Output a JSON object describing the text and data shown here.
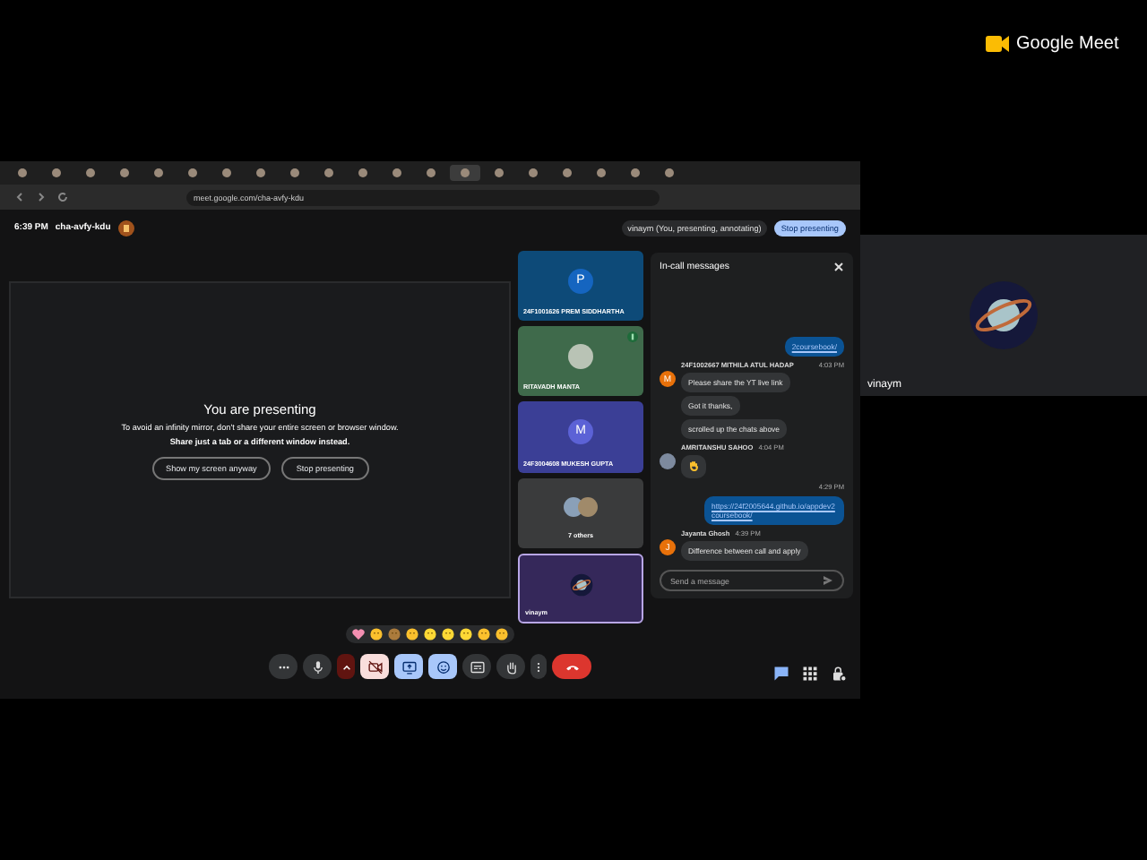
{
  "brand": {
    "name": "Google Meet"
  },
  "side_tile": {
    "name": "vinaym",
    "kind": "planet"
  },
  "browser": {
    "tabs": [
      {
        "selected": false
      },
      {
        "selected": false
      },
      {
        "selected": false
      },
      {
        "selected": false
      },
      {
        "selected": false
      },
      {
        "selected": false
      },
      {
        "selected": false
      },
      {
        "selected": false
      },
      {
        "selected": false
      },
      {
        "selected": false
      },
      {
        "selected": false
      },
      {
        "selected": false
      },
      {
        "selected": false
      },
      {
        "selected": true
      },
      {
        "selected": false
      },
      {
        "selected": false
      },
      {
        "selected": false
      },
      {
        "selected": false
      },
      {
        "selected": false
      },
      {
        "selected": false
      }
    ],
    "url": "meet.google.com/cha-avfy-kdu"
  },
  "meeting": {
    "time": "6:39 PM",
    "code": "cha-avfy-kdu",
    "presenter_label": "vinaym (You, presenting, annotating)",
    "stop_button": "Stop presenting"
  },
  "presenting_notice": {
    "title": "You are presenting",
    "line_1": "To avoid an infinity mirror, don't share your entire screen or browser window.",
    "line_2": "Share just a tab or a different window instead.",
    "buttons": [
      "Show my screen anyway",
      "Stop presenting"
    ]
  },
  "tiles": [
    {
      "name": "24F1001626 PREM SIDDHARTHA",
      "kind": "letter",
      "letter": "P",
      "color": "#0d4a78",
      "speaking": false
    },
    {
      "name": "RITAVADH MANTA",
      "kind": "photo",
      "color": "#3f6a4b",
      "speaking": true
    },
    {
      "name": "24F3004608 MUKESH GUPTA",
      "kind": "letter",
      "letter": "M",
      "color": "#3b3f96",
      "speaking": false
    },
    {
      "name": "7 others",
      "kind": "group",
      "color": "#3a3b3c",
      "speaking": false
    },
    {
      "name": "vinaym",
      "kind": "planet",
      "color": "#35285a",
      "speaking": false
    }
  ],
  "chat": {
    "title": "In-call messages",
    "placeholder": "Send a message",
    "groups": [
      {
        "own": true,
        "messages": [
          {
            "text": "2coursebook/",
            "link": true
          }
        ]
      },
      {
        "own": false,
        "sender": "24F1002667 MITHILA ATUL HADAP",
        "time": "4:03 PM",
        "kind": "letter",
        "letter": "M",
        "messages": [
          {
            "text": "Please share the YT live link",
            "link": false
          },
          {
            "text": "Got it thanks,",
            "link": false
          },
          {
            "text": "scrolled up the chats above",
            "link": false
          }
        ]
      },
      {
        "own": false,
        "sender": "AMRITANSHU SAHOO",
        "time": "4:04 PM",
        "kind": "photo",
        "messages": [
          {
            "kind": "hand"
          }
        ]
      },
      {
        "own": true,
        "time": "4:29 PM",
        "messages": [
          {
            "text": "https://24f2005644.github.io/appdev2coursebook/",
            "link": true
          }
        ]
      },
      {
        "own": false,
        "sender": "Jayanta Ghosh",
        "time": "4:39 PM",
        "kind": "letter",
        "letter": "J",
        "messages": [
          {
            "text": "Difference between call and apply",
            "link": false
          }
        ]
      }
    ]
  },
  "reactions": [
    {
      "kind": "heart"
    },
    {
      "kind": "thumbs-up"
    },
    {
      "kind": "party"
    },
    {
      "kind": "clap"
    },
    {
      "kind": "laugh"
    },
    {
      "kind": "surprise"
    },
    {
      "kind": "sad"
    },
    {
      "kind": "thinking"
    },
    {
      "kind": "thumbs-down"
    }
  ],
  "controls": [
    {
      "kind": "more"
    },
    {
      "kind": "mic"
    },
    {
      "kind": "caret"
    },
    {
      "kind": "camera-off"
    },
    {
      "kind": "present"
    },
    {
      "kind": "emoji"
    },
    {
      "kind": "captions"
    },
    {
      "kind": "hand"
    },
    {
      "kind": "menu"
    },
    {
      "kind": "end"
    }
  ],
  "side_controls": [
    {
      "kind": "chat"
    },
    {
      "kind": "apps"
    },
    {
      "kind": "lock"
    }
  ]
}
